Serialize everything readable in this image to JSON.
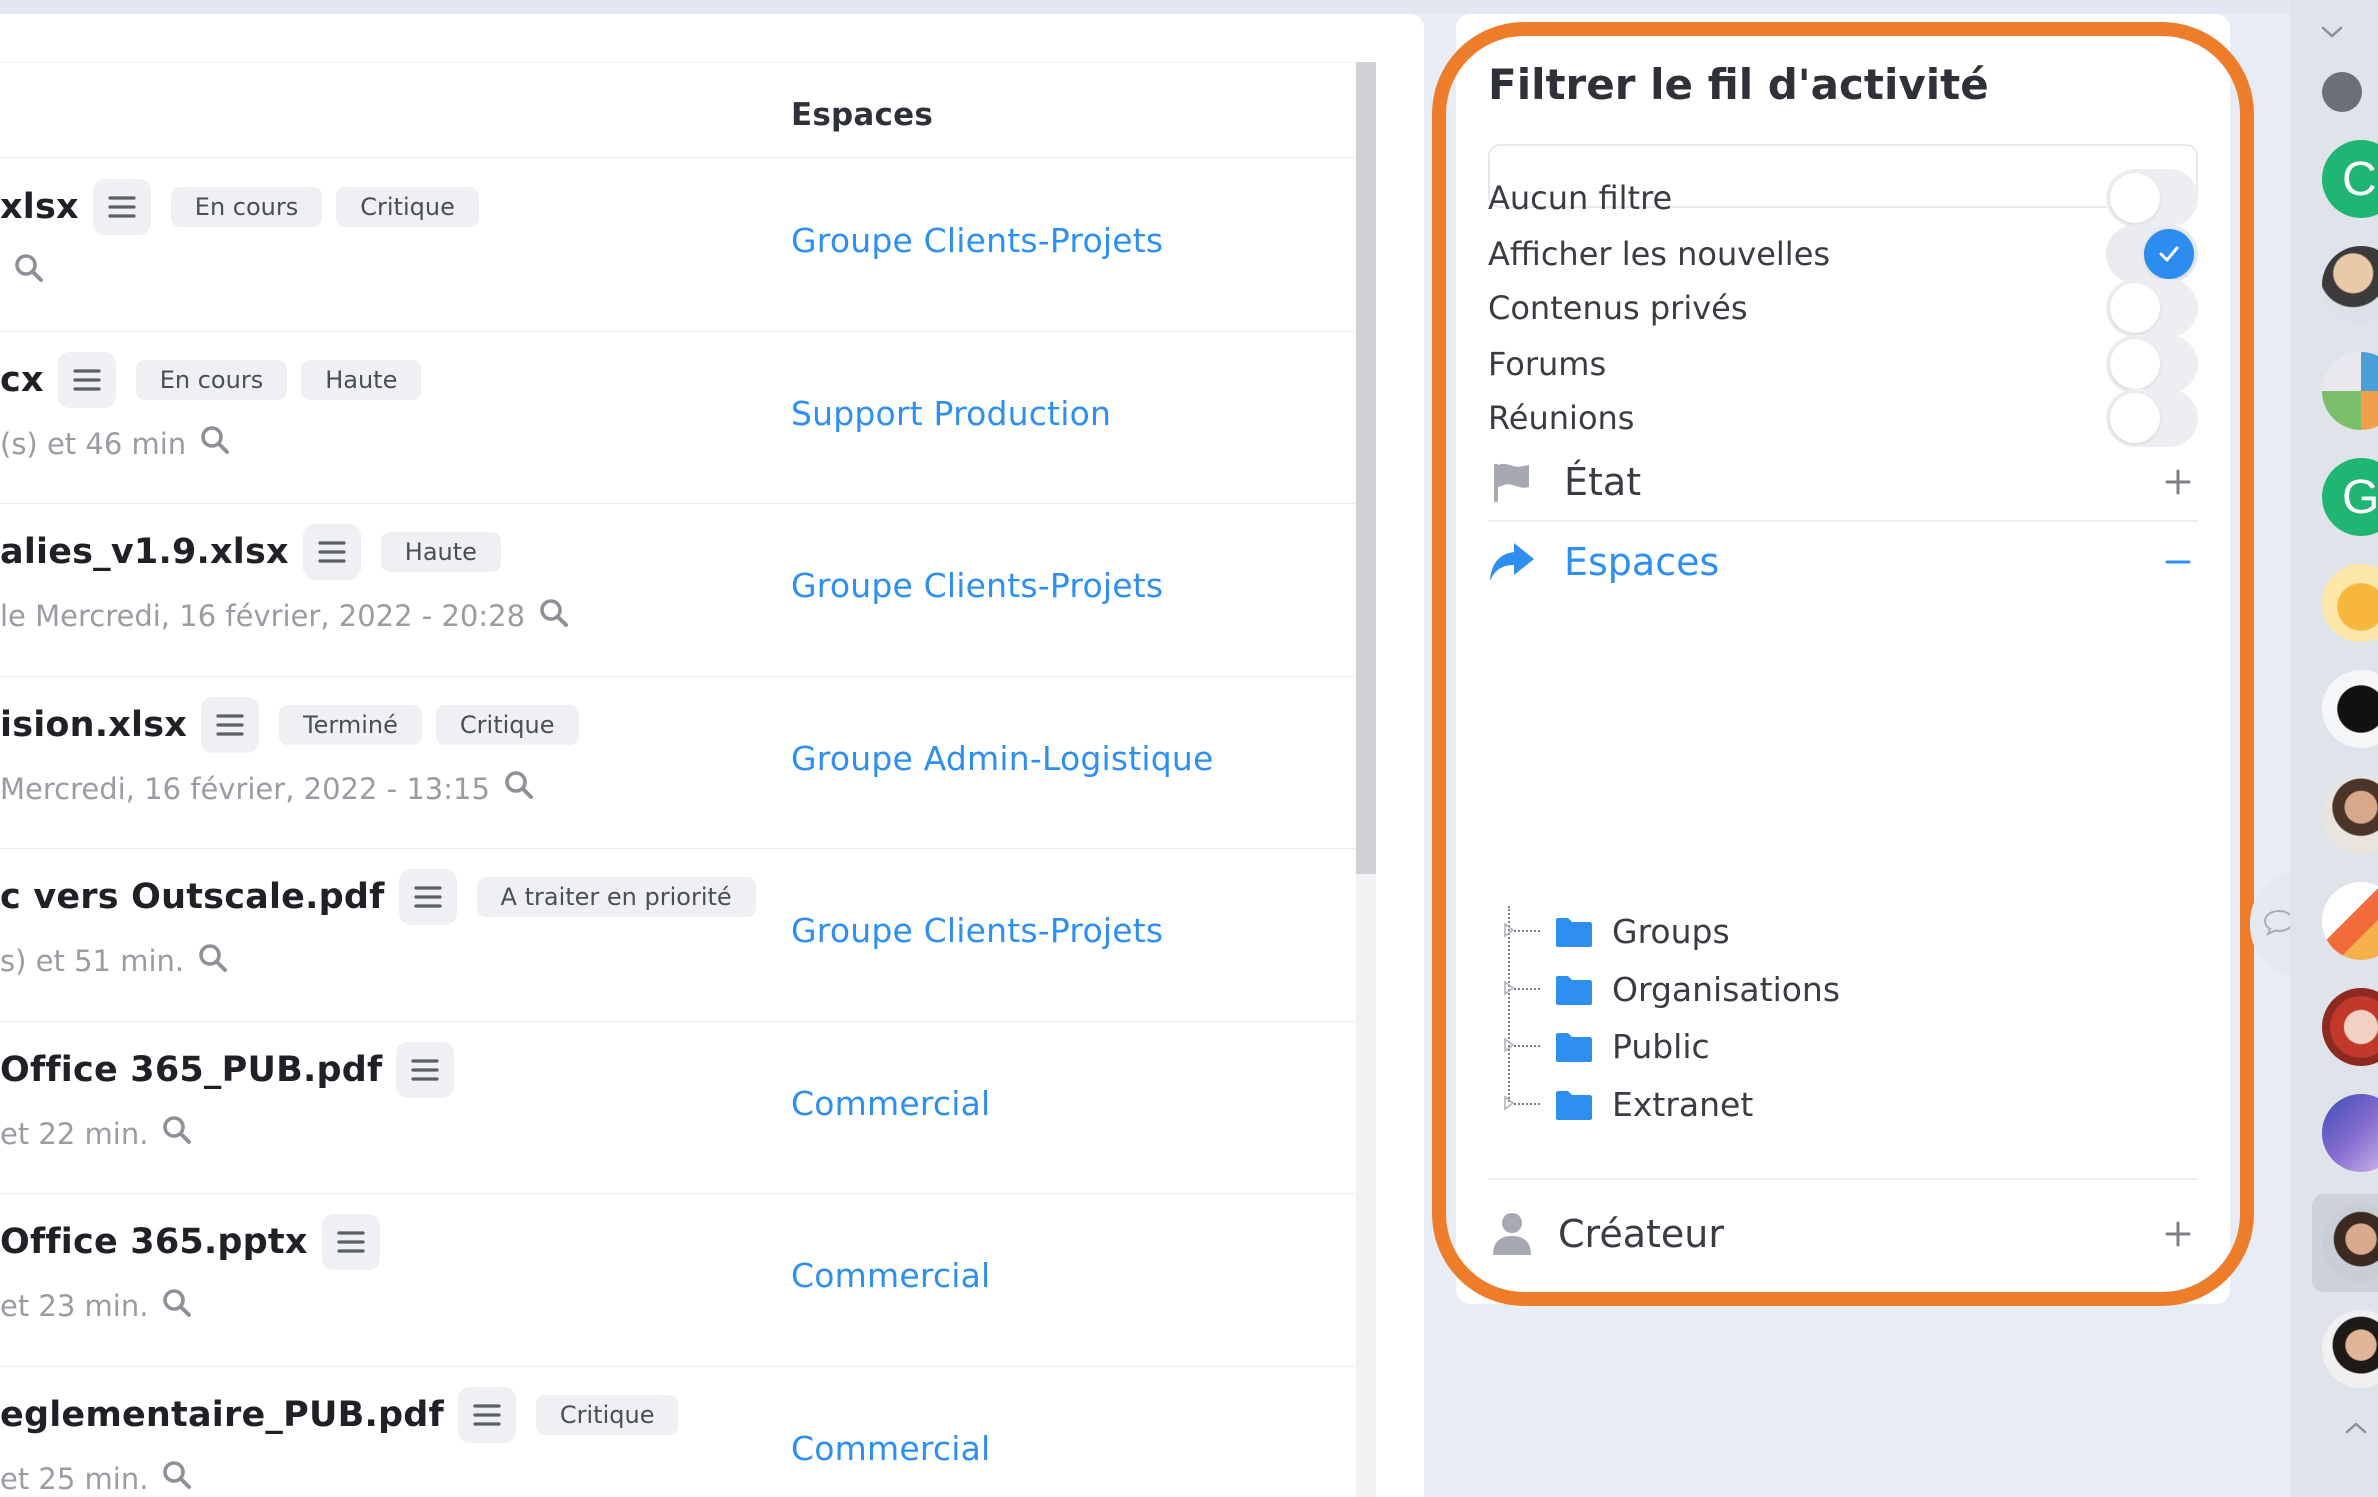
{
  "table": {
    "header_espaces": "Espaces",
    "rows": [
      {
        "name": "xlsx",
        "tags": [
          "En cours",
          "Critique"
        ],
        "meta": "",
        "space": "Groupe Clients-Projets"
      },
      {
        "name": "cx",
        "tags": [
          "En cours",
          "Haute"
        ],
        "meta": "(s) et 46 min",
        "space": "Support Production"
      },
      {
        "name": "alies_v1.9.xlsx",
        "tags": [
          "Haute"
        ],
        "meta": "le Mercredi, 16 février, 2022 - 20:28",
        "space": "Groupe Clients-Projets"
      },
      {
        "name": "ision.xlsx",
        "tags": [
          "Terminé",
          "Critique"
        ],
        "meta": "Mercredi, 16 février, 2022 - 13:15",
        "space": "Groupe Admin-Logistique"
      },
      {
        "name": "c vers Outscale.pdf",
        "tags": [
          "A traiter en priorité"
        ],
        "meta": "s) et 51 min.",
        "space": "Groupe Clients-Projets"
      },
      {
        "name": "Office 365_PUB.pdf",
        "tags": [],
        "meta": "et 22 min.",
        "space": "Commercial"
      },
      {
        "name": "Office 365.pptx",
        "tags": [],
        "meta": "et 23 min.",
        "space": "Commercial"
      },
      {
        "name": "eglementaire_PUB.pdf",
        "tags": [
          "Critique"
        ],
        "meta": "et 25 min.",
        "space": "Commercial"
      }
    ]
  },
  "filter": {
    "title": "Filtrer le fil d'activité",
    "search_value": "",
    "toggles": [
      {
        "label": "Aucun filtre",
        "on": false
      },
      {
        "label": "Afficher les nouvelles",
        "on": true
      },
      {
        "label": "Contenus privés",
        "on": false
      },
      {
        "label": "Forums",
        "on": false
      },
      {
        "label": "Réunions",
        "on": false
      }
    ],
    "sections": {
      "etat": {
        "label": "État",
        "icon": "flag-icon",
        "expanded": false
      },
      "espaces": {
        "label": "Espaces",
        "icon": "share-arrow-icon",
        "expanded": true
      },
      "createur": {
        "label": "Créateur",
        "icon": "user-icon",
        "expanded": false
      }
    },
    "tree": [
      "Groups",
      "Organisations",
      "Public",
      "Extranet"
    ]
  },
  "rail": {
    "letter_avatars": [
      "C",
      "G"
    ]
  },
  "colors": {
    "accent": "#2f8ff0",
    "highlight": "#ee7d2b",
    "tag_bg": "#eef0f3",
    "toggle_on": "#2d8cf0",
    "avatar_green": "#21b573"
  }
}
